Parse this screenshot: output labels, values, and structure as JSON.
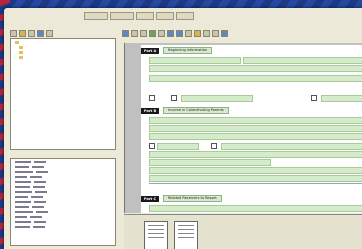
{
  "menu": {
    "items": [
      "",
      "",
      "",
      "",
      ""
    ]
  },
  "document": {
    "sections": [
      {
        "label": "Part A",
        "title": "",
        "hint": "Beginning information"
      },
      {
        "label": "Part B",
        "title": "",
        "hint": "Income in Collectivizing Parents"
      },
      {
        "label": "Part C",
        "title": "",
        "hint": "Related Receivers to Report"
      }
    ]
  },
  "colors": {
    "desktop": "#1f3f8c",
    "window": "#ece9d8",
    "field": "#d4ecc9"
  }
}
